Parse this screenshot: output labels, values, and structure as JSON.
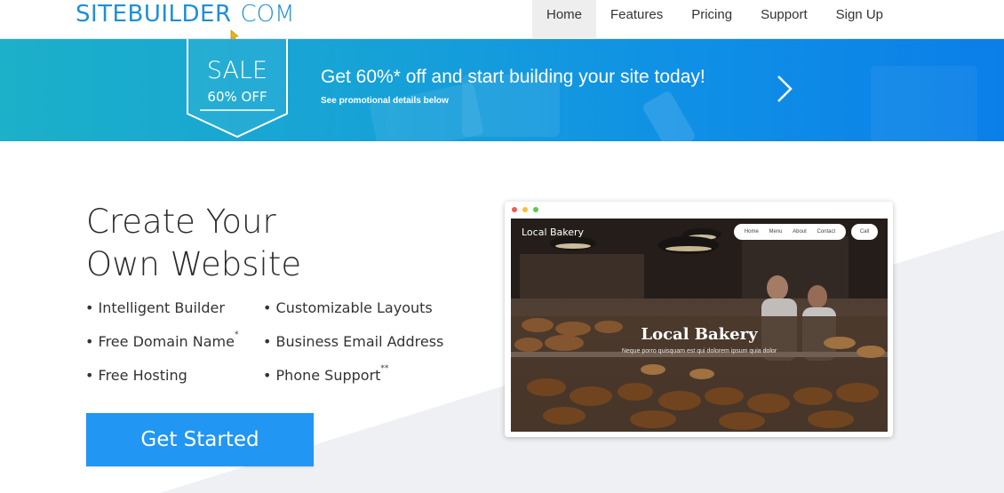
{
  "header": {
    "logo_main": "SITEBUILDER",
    "logo_com": "COM",
    "nav": [
      {
        "label": "Home",
        "active": true
      },
      {
        "label": "Features",
        "active": false
      },
      {
        "label": "Pricing",
        "active": false
      },
      {
        "label": "Support",
        "active": false
      },
      {
        "label": "Sign Up",
        "active": false
      }
    ]
  },
  "banner": {
    "badge_word": "SALE",
    "badge_sub": "60% OFF",
    "headline": "Get 60%* off and start building your site today!",
    "subtext": "See promotional details below",
    "arrow_icon": "chevron-right-icon"
  },
  "hero": {
    "title_line1": "Create Your",
    "title_line2": "Own Website",
    "features": [
      {
        "text": "• Intelligent Builder",
        "mark": ""
      },
      {
        "text": "• Customizable Layouts",
        "mark": ""
      },
      {
        "text": "• Free Domain Name",
        "mark": "*"
      },
      {
        "text": "• Business Email Address",
        "mark": ""
      },
      {
        "text": "• Free Hosting",
        "mark": ""
      },
      {
        "text": "• Phone Support",
        "mark": "**"
      }
    ],
    "cta_label": "Get Started"
  },
  "mockup": {
    "site_title": "Local Bakery",
    "nav": [
      "Home",
      "Menu",
      "About",
      "Contact"
    ],
    "call_label": "Call",
    "hero_title": "Local Bakery",
    "hero_sub": "Neque porro quisquam est qui dolorem ipsum quia dolor"
  },
  "colors": {
    "brand": "#1f8fd6",
    "cta": "#2196f3",
    "banner_start": "#1cb0c9",
    "banner_end": "#0a7fe8"
  }
}
